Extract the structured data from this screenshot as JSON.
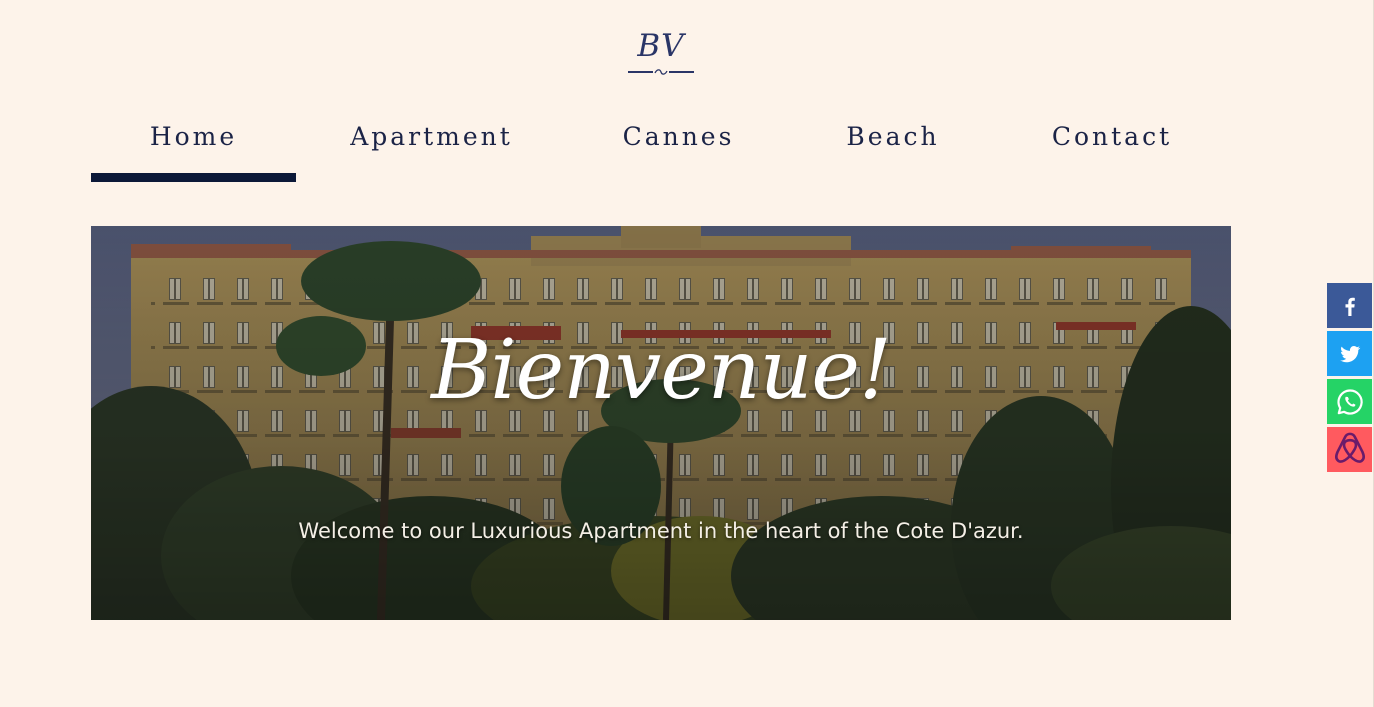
{
  "logo": {
    "text": "BV"
  },
  "nav": {
    "items": [
      {
        "label": "Home",
        "active": true
      },
      {
        "label": "Apartment",
        "active": false
      },
      {
        "label": "Cannes",
        "active": false
      },
      {
        "label": "Beach",
        "active": false
      },
      {
        "label": "Contact",
        "active": false
      }
    ]
  },
  "hero": {
    "title": "Bienvenue!",
    "subtitle": "Welcome to our Luxurious Apartment in the heart of the Cote D'azur."
  },
  "share": {
    "items": [
      {
        "icon": "facebook-icon",
        "color": "#3b5998"
      },
      {
        "icon": "twitter-icon",
        "color": "#1da1f2"
      },
      {
        "icon": "whatsapp-icon",
        "color": "#25d366"
      },
      {
        "icon": "airbnb-icon",
        "color": "#ff5a5f"
      }
    ]
  },
  "colors": {
    "background": "#fdf3ea",
    "text": "#1b2346",
    "active_underline": "#0c1838"
  }
}
